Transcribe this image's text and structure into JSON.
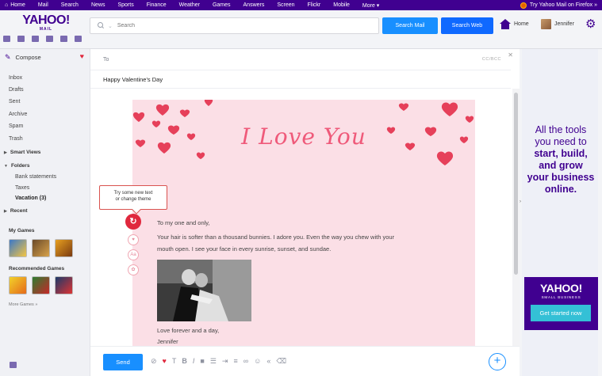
{
  "topnav": {
    "items": [
      "Home",
      "Mail",
      "Search",
      "News",
      "Sports",
      "Finance",
      "Weather",
      "Games",
      "Answers",
      "Screen",
      "Flickr",
      "Mobile",
      "More ▾"
    ],
    "firefox": "Try Yahoo Mail on Firefox »"
  },
  "header": {
    "logo": "YAHOO!",
    "logo_sub": "MAIL",
    "search_placeholder": "Search",
    "search_mail": "Search Mail",
    "search_web": "Search Web",
    "home": "Home",
    "user": "Jennifer"
  },
  "sidebar": {
    "compose": "Compose",
    "folders": [
      "Inbox",
      "Drafts",
      "Sent",
      "Archive",
      "Spam",
      "Trash"
    ],
    "smart_views": "Smart Views",
    "folders_head": "Folders",
    "sub_folders": [
      "Bank statements",
      "Taxes",
      "Vacation (3)"
    ],
    "recent": "Recent",
    "my_games": "My Games",
    "recommended_games": "Recommended Games",
    "more_games": "More Games »"
  },
  "compose": {
    "to_label": "To",
    "cc_label": "CC/BCC",
    "subject": "Happy Valentine's Day",
    "card_title": "I Love You",
    "greeting": "To my one and only,",
    "body_line1": "Your hair is softer than a thousand bunnies. I adore you. Even the way you chew with your",
    "body_line2": "mouth open. I see your face in every sunrise, sunset, and sundae.",
    "closing": "Love forever and a day,",
    "signature": "Jennifer",
    "tooltip_line1": "Try some new text",
    "tooltip_line2": "or change theme",
    "send": "Send"
  },
  "ad": {
    "line1": "All the tools",
    "line2": "you need to",
    "line3": "start, build,",
    "line4": "and grow",
    "line5": "your business",
    "line6": "online.",
    "logo": "YAHOO!",
    "logo_sub": "SMALL BUSINESS",
    "cta": "Get started now"
  },
  "colors": {
    "brand_purple": "#400090",
    "accent_blue": "#188fff",
    "heart_red": "#e0283d",
    "card_pink": "#fbdfe6"
  }
}
